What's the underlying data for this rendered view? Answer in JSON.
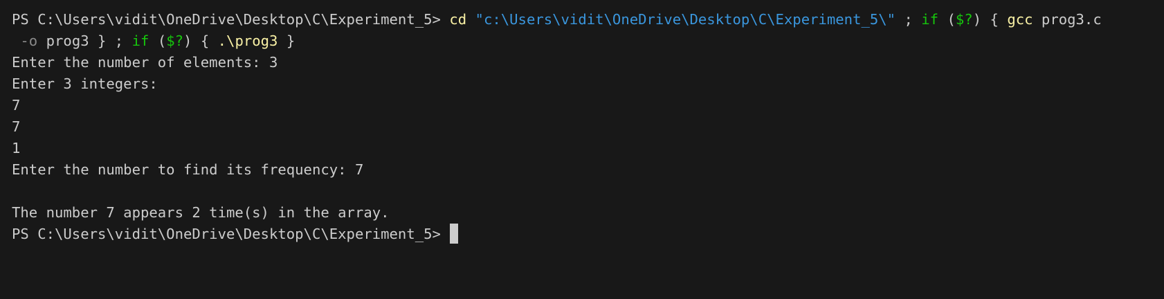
{
  "terminal": {
    "prompt": "PS C:\\Users\\vidit\\OneDrive\\Desktop\\C\\Experiment_5> ",
    "command": {
      "cd": "cd",
      "path": "\"c:\\Users\\vidit\\OneDrive\\Desktop\\C\\Experiment_5\\\"",
      "sep1": " ; ",
      "if1": "if",
      "open1": " (",
      "cond1": "$?",
      "close1": ") { ",
      "gcc": "gcc",
      "src": " prog3.c",
      "indent": " ",
      "flag_o": "-o",
      "out": " prog3 } ; ",
      "if2": "if",
      "open2": " (",
      "cond2": "$?",
      "close2": ") { ",
      "run": ".\\prog3",
      "end": " }"
    },
    "output": [
      "Enter the number of elements: 3",
      "Enter 3 integers:",
      "7",
      "7",
      "1",
      "Enter the number to find its frequency: 7",
      "",
      "The number 7 appears 2 time(s) in the array."
    ],
    "final_prompt": "PS C:\\Users\\vidit\\OneDrive\\Desktop\\C\\Experiment_5> "
  },
  "colors": {
    "background": "#181818",
    "text": "#cccccc",
    "command": "#f9f1a5",
    "string": "#3a96dd",
    "keyword": "#16c60c"
  }
}
